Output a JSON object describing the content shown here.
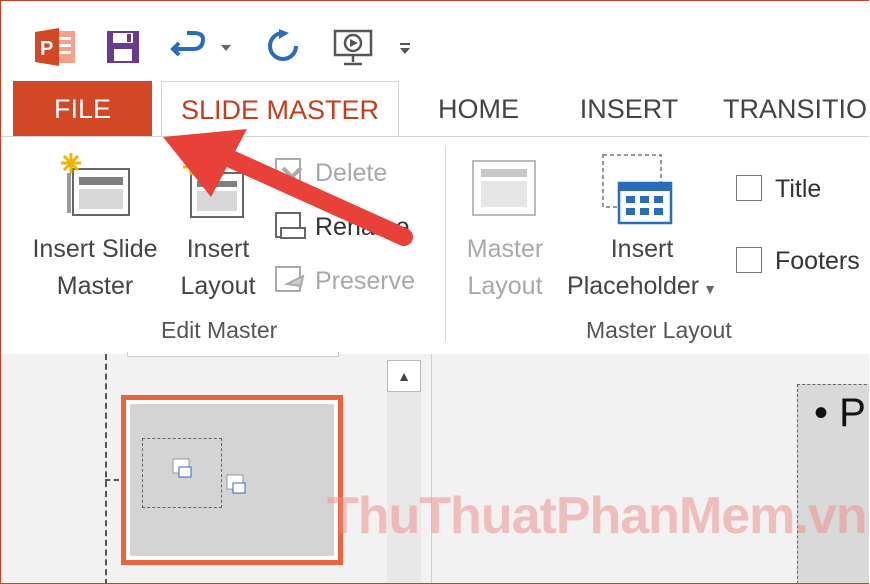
{
  "quick_access": {
    "icons": [
      "powerpoint-logo-icon",
      "save-icon",
      "undo-icon",
      "repeat-icon",
      "presentation-icon",
      "customize-icon"
    ]
  },
  "tabs": [
    {
      "label": "FILE"
    },
    {
      "label": "SLIDE MASTER"
    },
    {
      "label": "HOME"
    },
    {
      "label": "INSERT"
    },
    {
      "label": "TRANSITIO"
    }
  ],
  "ribbon": {
    "edit_master": {
      "group_label": "Edit Master",
      "insert_slide_master": [
        "Insert Slide",
        "Master"
      ],
      "insert_layout": [
        "Insert",
        "Layout"
      ],
      "delete": "Delete",
      "rename": "Rename",
      "preserve": "Preserve"
    },
    "master_layout": {
      "group_label": "Master Layout",
      "master_layout": [
        "Master",
        "Layout"
      ],
      "insert_placeholder": [
        "Insert",
        "Placeholder"
      ],
      "title": "Title",
      "footers": "Footers"
    }
  },
  "slide_canvas": {
    "bullet": "• P"
  },
  "watermark": {
    "text": "ThuThuatPhanMem.vn"
  },
  "colors": {
    "accent": "#d24726",
    "active_tab_text": "#c43e1c",
    "arrow": "#e8413a"
  }
}
